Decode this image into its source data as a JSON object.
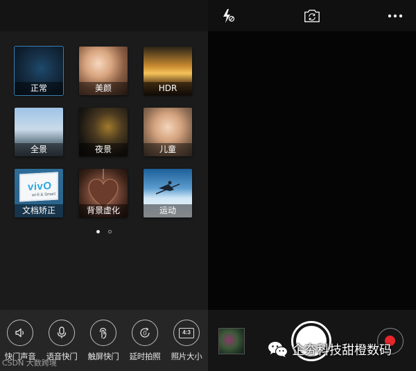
{
  "colors": {
    "accent_selected": "#3a7fb0",
    "record": "#e8252a",
    "panel_bg": "#1b1b1b",
    "viewfinder_bg": "#050505"
  },
  "modes": [
    {
      "label": "正常",
      "icon": "normal-mode-thumbnail",
      "selected": true
    },
    {
      "label": "美颜",
      "icon": "beauty-mode-thumbnail",
      "selected": false
    },
    {
      "label": "HDR",
      "icon": "hdr-mode-thumbnail",
      "selected": false
    },
    {
      "label": "全景",
      "icon": "panorama-mode-thumbnail",
      "selected": false
    },
    {
      "label": "夜景",
      "icon": "night-mode-thumbnail",
      "selected": false
    },
    {
      "label": "儿童",
      "icon": "kids-mode-thumbnail",
      "selected": false
    },
    {
      "label": "文档矫正",
      "icon": "document-mode-thumbnail",
      "selected": false
    },
    {
      "label": "背景虚化",
      "icon": "bokeh-mode-thumbnail",
      "selected": false
    },
    {
      "label": "运动",
      "icon": "sport-mode-thumbnail",
      "selected": false
    }
  ],
  "doc_thumbnail": {
    "logo": "vivO",
    "sub": "wi-fi & Smart"
  },
  "pager": {
    "pages": 2,
    "current": 1
  },
  "settings": [
    {
      "label": "快门声音",
      "icon": "speaker-icon"
    },
    {
      "label": "语音快门",
      "icon": "microphone-icon"
    },
    {
      "label": "触屏快门",
      "icon": "touch-icon"
    },
    {
      "label": "延时拍照",
      "icon": "timer-icon",
      "value": "0"
    },
    {
      "label": "照片大小",
      "icon": "aspect-ratio-icon",
      "value": "4:3"
    }
  ],
  "watermark": "CSDN 大数跨境",
  "topbar": {
    "flash_icon": "flash-off-icon",
    "switch_icon": "switch-camera-icon",
    "more_icon": "more-icon"
  },
  "bottom": {
    "wechat_text": "企夯科技甜橙数码"
  }
}
